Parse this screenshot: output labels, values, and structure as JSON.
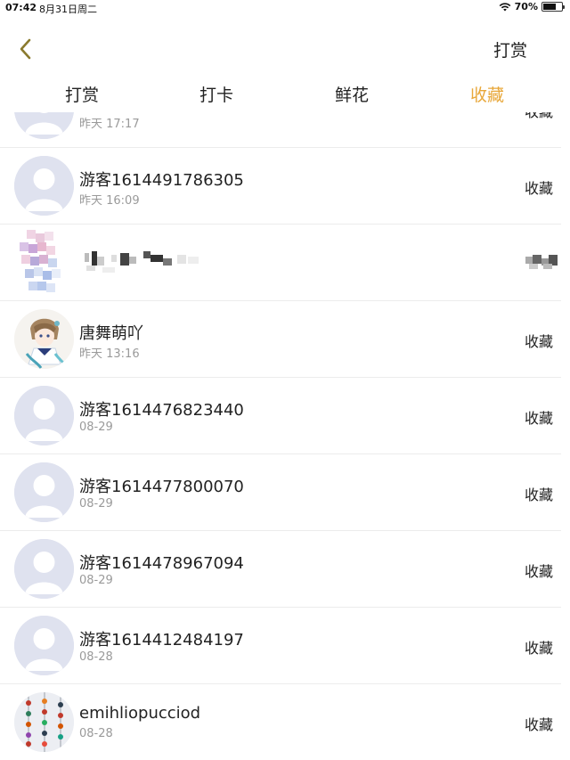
{
  "status_bar": {
    "time": "07:42",
    "date": "8月31日周二",
    "battery": "70%",
    "battery_level": 0.7
  },
  "header": {
    "back_icon": "chevron-left-icon",
    "right_title": "打赏"
  },
  "tabs": [
    {
      "label": "打赏",
      "active": false
    },
    {
      "label": "打卡",
      "active": false
    },
    {
      "label": "鲜花",
      "active": false
    },
    {
      "label": "收藏",
      "active": true
    }
  ],
  "list": [
    {
      "name": "",
      "time": "昨天 17:17",
      "action": "收藏",
      "avatar": "default"
    },
    {
      "name": "游客1614491786305",
      "time": "昨天 16:09",
      "action": "收藏",
      "avatar": "default"
    },
    {
      "name": "",
      "time": "",
      "action": "",
      "avatar": "blurred"
    },
    {
      "name": "唐舞萌吖",
      "time": "昨天 13:16",
      "action": "收藏",
      "avatar": "anime"
    },
    {
      "name": "游客1614476823440",
      "time": "08-29",
      "action": "收藏",
      "avatar": "default"
    },
    {
      "name": "游客1614477800070",
      "time": "08-29",
      "action": "收藏",
      "avatar": "default"
    },
    {
      "name": "游客1614478967094",
      "time": "08-29",
      "action": "收藏",
      "avatar": "default"
    },
    {
      "name": "游客1614412484197",
      "time": "08-28",
      "action": "收藏",
      "avatar": "default"
    },
    {
      "name": "emihliopucciod",
      "time": "08-28",
      "action": "收藏",
      "avatar": "ornaments"
    }
  ],
  "colors": {
    "accent": "#e8a739",
    "text": "#222222",
    "subtext": "#9a9a9a",
    "divider": "#ececec",
    "avatar_bg": "#dfe2ef"
  }
}
